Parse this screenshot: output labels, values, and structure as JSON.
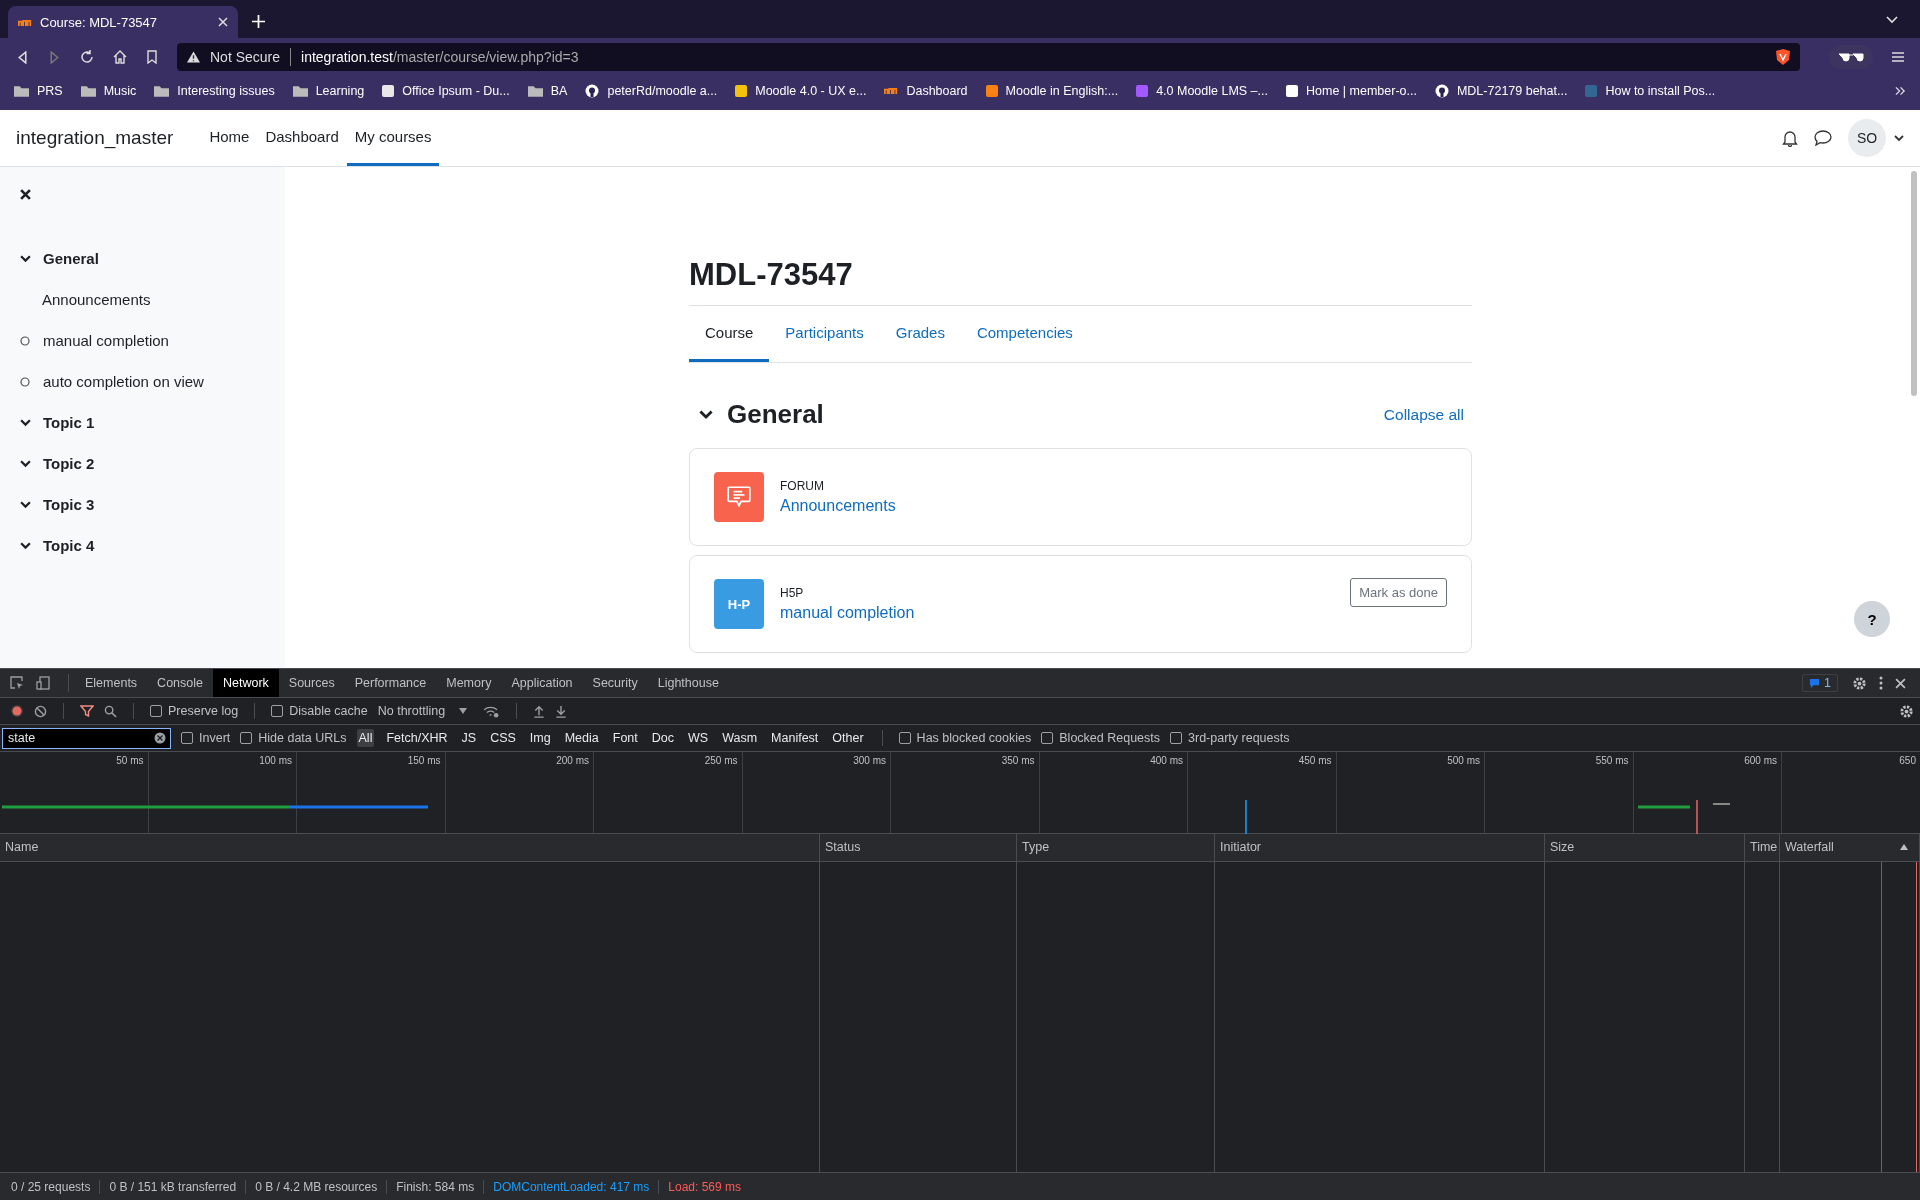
{
  "browser": {
    "tab_title": "Course: MDL-73547",
    "address": {
      "security": "Not Secure",
      "host": "integration.test",
      "path": "/master/course/view.php?id=3"
    },
    "bookmarks": [
      {
        "label": "PRS",
        "kind": "folder"
      },
      {
        "label": "Music",
        "kind": "folder"
      },
      {
        "label": "Interesting issues",
        "kind": "folder"
      },
      {
        "label": "Learning",
        "kind": "folder"
      },
      {
        "label": "Office Ipsum - Du...",
        "kind": "site",
        "color": "#e8e8e8"
      },
      {
        "label": "BA",
        "kind": "folder"
      },
      {
        "label": "peterRd/moodle a...",
        "kind": "github"
      },
      {
        "label": "Moodle 4.0 - UX e...",
        "kind": "site",
        "color": "#f4c20d"
      },
      {
        "label": "Dashboard",
        "kind": "moodle"
      },
      {
        "label": "Moodle in English:...",
        "kind": "site",
        "color": "#f98012"
      },
      {
        "label": "4.0 Moodle LMS –...",
        "kind": "site",
        "color": "#a259ff"
      },
      {
        "label": "Home | member-o...",
        "kind": "site",
        "color": "#ffffff"
      },
      {
        "label": "MDL-72179 behat...",
        "kind": "github"
      },
      {
        "label": "How to install Pos...",
        "kind": "site",
        "color": "#336791"
      }
    ]
  },
  "navbar": {
    "brand": "integration_master",
    "items": [
      {
        "label": "Home",
        "selected": false
      },
      {
        "label": "Dashboard",
        "selected": false
      },
      {
        "label": "My courses",
        "selected": true
      }
    ],
    "avatar": "SO"
  },
  "sidebar": {
    "items": [
      {
        "label": "General",
        "kind": "section",
        "expanded": true,
        "children": [
          {
            "label": "Announcements",
            "kind": "activity"
          }
        ]
      },
      {
        "label": "manual completion",
        "kind": "activity_status"
      },
      {
        "label": "auto completion on view",
        "kind": "activity_status"
      },
      {
        "label": "Topic 1",
        "kind": "section",
        "expanded": true
      },
      {
        "label": "Topic 2",
        "kind": "section",
        "expanded": true
      },
      {
        "label": "Topic 3",
        "kind": "section",
        "expanded": true
      },
      {
        "label": "Topic 4",
        "kind": "section",
        "expanded": true
      }
    ]
  },
  "course": {
    "title": "MDL-73547",
    "tabs": [
      {
        "label": "Course",
        "selected": true
      },
      {
        "label": "Participants",
        "selected": false
      },
      {
        "label": "Grades",
        "selected": false
      },
      {
        "label": "Competencies",
        "selected": false
      }
    ],
    "section": {
      "title": "General",
      "expanded": true,
      "collapse_all": "Collapse all"
    },
    "activities": [
      {
        "kind": "forum",
        "type_label": "FORUM",
        "name": "Announcements"
      },
      {
        "kind": "h5p",
        "type_label": "H5P",
        "name": "manual completion",
        "button": "Mark as done",
        "icon_text": "H-P"
      }
    ],
    "help": "?"
  },
  "devtools": {
    "tabs": [
      {
        "label": "Elements",
        "selected": false
      },
      {
        "label": "Console",
        "selected": false
      },
      {
        "label": "Network",
        "selected": true
      },
      {
        "label": "Sources",
        "selected": false
      },
      {
        "label": "Performance",
        "selected": false
      },
      {
        "label": "Memory",
        "selected": false
      },
      {
        "label": "Application",
        "selected": false
      },
      {
        "label": "Security",
        "selected": false
      },
      {
        "label": "Lighthouse",
        "selected": false
      }
    ],
    "issues_count": "1",
    "toolbar": {
      "preserve_log": {
        "label": "Preserve log",
        "checked": false
      },
      "disable_cache": {
        "label": "Disable cache",
        "checked": false
      },
      "throttling": "No throttling"
    },
    "filter": {
      "value": "state",
      "invert": {
        "label": "Invert",
        "checked": false
      },
      "hide_data_urls": {
        "label": "Hide data URLs",
        "checked": false
      },
      "types": [
        {
          "label": "All",
          "selected": true
        },
        {
          "label": "Fetch/XHR",
          "selected": false
        },
        {
          "label": "JS",
          "selected": false
        },
        {
          "label": "CSS",
          "selected": false
        },
        {
          "label": "Img",
          "selected": false
        },
        {
          "label": "Media",
          "selected": false
        },
        {
          "label": "Font",
          "selected": false
        },
        {
          "label": "Doc",
          "selected": false
        },
        {
          "label": "WS",
          "selected": false
        },
        {
          "label": "Wasm",
          "selected": false
        },
        {
          "label": "Manifest",
          "selected": false
        },
        {
          "label": "Other",
          "selected": false
        }
      ],
      "options": [
        {
          "label": "Has blocked cookies",
          "checked": false
        },
        {
          "label": "Blocked Requests",
          "checked": false
        },
        {
          "label": "3rd-party requests",
          "checked": false
        }
      ]
    },
    "timeline_ticks": [
      "50 ms",
      "100 ms",
      "150 ms",
      "200 ms",
      "250 ms",
      "300 ms",
      "350 ms",
      "400 ms",
      "450 ms",
      "500 ms",
      "550 ms",
      "600 ms",
      "650"
    ],
    "table": {
      "columns": [
        "Name",
        "Status",
        "Type",
        "Initiator",
        "Size",
        "Time",
        "Waterfall"
      ]
    },
    "status_bar": [
      {
        "text": "0 / 25 requests",
        "kind": "normal"
      },
      {
        "text": "0 B / 151 kB transferred",
        "kind": "normal"
      },
      {
        "text": "0 B / 4.2 MB resources",
        "kind": "normal"
      },
      {
        "text": "Finish: 584 ms",
        "kind": "normal"
      },
      {
        "text": "DOMContentLoaded: 417 ms",
        "kind": "dcl"
      },
      {
        "text": "Load: 569 ms",
        "kind": "load"
      }
    ]
  }
}
